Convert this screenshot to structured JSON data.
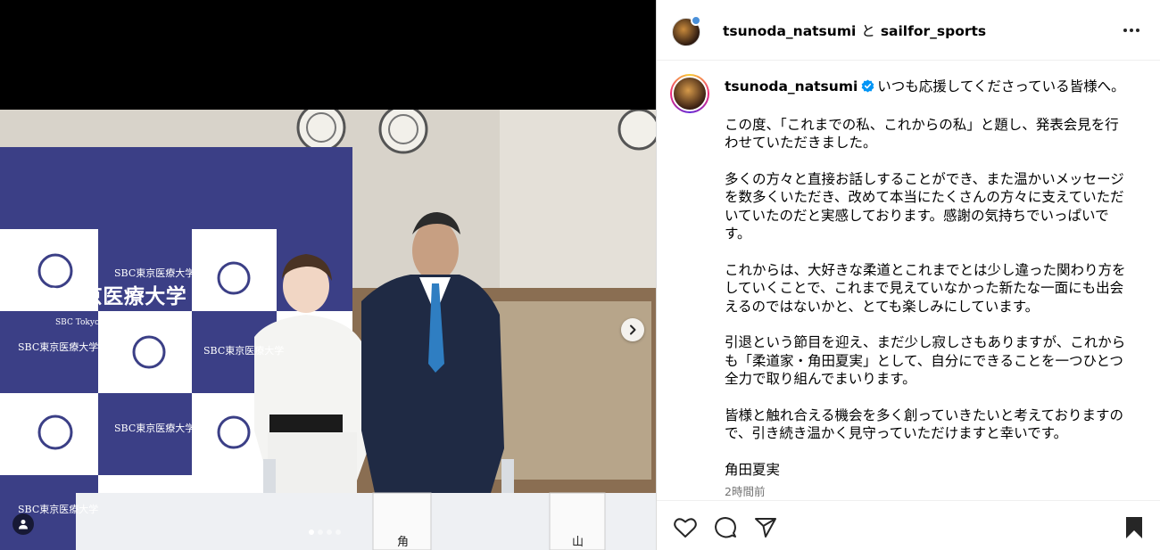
{
  "media": {
    "banner_title": "SBC東京医療大学",
    "banner_subtitle": "SBC Tokyo Medical University",
    "cell_label": "SBC東京医療大学",
    "name_card_1": "角",
    "name_card_2": "山",
    "carousel_dots": 4,
    "carousel_active_index": 0
  },
  "header": {
    "user1": "tsunoda_natsumi",
    "conjunction": "と",
    "user2": "sailfor_sports"
  },
  "caption": {
    "username": "tsunoda_natsumi",
    "first_line": "いつも応援してくださっている皆様へ。",
    "paragraphs": [
      "この度、「これまでの私、これからの私」と題し、発表会見を行わせていただきました。",
      "多くの方々と直接お話しすることができ、また温かいメッセージを数多くいただき、改めて本当にたくさんの方々に支えていただいていたのだと実感しております。感謝の気持ちでいっぱいです。",
      "これからは、大好きな柔道とこれまでとは少し違った関わり方をしていくことで、これまで見えていなかった新たな一面にも出会えるのではないかと、とても楽しみにしています。",
      "引退という節目を迎え、まだ少し寂しさもありますが、これからも「柔道家・角田夏実」として、自分にできることを一つひとつ全力で取り組んでまいります。",
      "皆様と触れ合える機会を多く創っていきたいと考えておりますので、引き続き温かく見守っていただけますと幸いです。",
      "角田夏実"
    ],
    "timestamp": "2時間前"
  },
  "icons": {
    "more": "more-icon",
    "verified": "verified-icon",
    "like": "heart-icon",
    "comment": "comment-icon",
    "share": "share-icon",
    "save": "bookmark-icon",
    "next": "chevron-right-icon",
    "tag": "user-tag-icon"
  },
  "colors": {
    "verified": "#0095f6",
    "banner": "#3b3f86"
  }
}
